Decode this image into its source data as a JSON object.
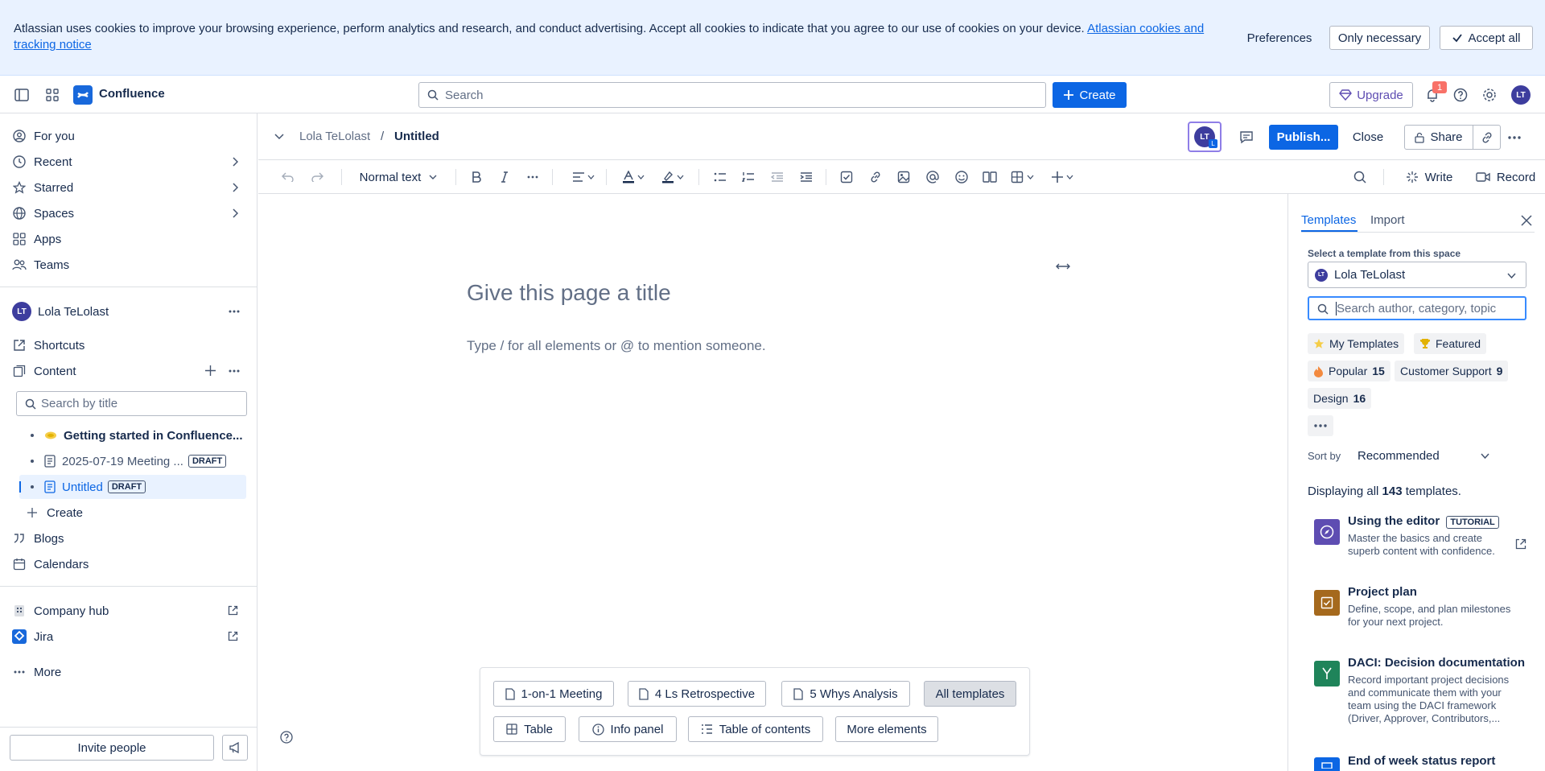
{
  "cookie_banner": {
    "text": "Atlassian uses cookies to improve your browsing experience, perform analytics and research, and conduct advertising. Accept all cookies to indicate that you agree to our use of cookies on your device.",
    "link": "Atlassian cookies and tracking notice",
    "preferences": "Preferences",
    "only_necessary": "Only necessary",
    "accept_all": "Accept all"
  },
  "topnav": {
    "app_name": "Confluence",
    "search_placeholder": "Search",
    "create": "Create",
    "upgrade": "Upgrade",
    "notification_count": "1",
    "avatar": "LT"
  },
  "sidebar": {
    "nav": [
      {
        "label": "For you"
      },
      {
        "label": "Recent"
      },
      {
        "label": "Starred"
      },
      {
        "label": "Spaces"
      },
      {
        "label": "Apps"
      },
      {
        "label": "Teams"
      }
    ],
    "space": {
      "avatar": "LT",
      "name": "Lola TeLolast"
    },
    "shortcuts": "Shortcuts",
    "content": "Content",
    "search_placeholder": "Search by title",
    "tree": [
      {
        "label": "Getting started in Confluence...",
        "badge": ""
      },
      {
        "label": "2025-07-19 Meeting ...",
        "badge": "DRAFT"
      },
      {
        "label": "Untitled",
        "badge": "DRAFT"
      }
    ],
    "create": "Create",
    "blogs": "Blogs",
    "calendars": "Calendars",
    "company_hub": "Company hub",
    "jira": "Jira",
    "more": "More",
    "invite": "Invite people"
  },
  "editor": {
    "breadcrumb_space": "Lola TeLolast",
    "breadcrumb_sep": "/",
    "breadcrumb_page": "Untitled",
    "collab_avatar": "LT",
    "collab_badge": "L",
    "publish": "Publish...",
    "close": "Close",
    "share": "Share",
    "text_style": "Normal text",
    "write": "Write",
    "record": "Record",
    "title_placeholder": "Give this page a title",
    "body_placeholder": "Type / for all elements or @ to mention someone."
  },
  "template_bar": {
    "row1": [
      "1-on-1 Meeting",
      "4 Ls Retrospective",
      "5 Whys Analysis",
      "All templates"
    ],
    "row2": [
      "Table",
      "Info panel",
      "Table of contents",
      "More elements"
    ]
  },
  "right_panel": {
    "tabs": [
      "Templates",
      "Import"
    ],
    "select_label": "Select a template from this space",
    "space_avatar": "LT",
    "space_name": "Lola TeLolast",
    "search_placeholder": "Search author, category, topic",
    "chips": [
      {
        "label": "My Templates",
        "count": ""
      },
      {
        "label": "Featured",
        "count": ""
      },
      {
        "label": "Popular",
        "count": "15"
      },
      {
        "label": "Customer Support",
        "count": "9"
      },
      {
        "label": "Design",
        "count": "16"
      }
    ],
    "sort_label": "Sort by",
    "sort_value": "Recommended",
    "displaying_prefix": "Displaying all",
    "displaying_count": "143",
    "displaying_suffix": "templates.",
    "templates": [
      {
        "name": "Using the editor",
        "badge": "TUTORIAL",
        "desc": "Master the basics and create superb content with confidence.",
        "color": "#5e4db2"
      },
      {
        "name": "Project plan",
        "badge": "",
        "desc": "Define, scope, and plan milestones for your next project.",
        "color": "#a5691d"
      },
      {
        "name": "DACI: Decision documentation",
        "badge": "",
        "desc": "Record important project decisions and communicate them with your team using the DACI framework (Driver, Approver, Contributors,...",
        "color": "#1f845a"
      },
      {
        "name": "End of week status report",
        "badge": "",
        "desc": "",
        "color": "#0c66e4"
      }
    ]
  }
}
